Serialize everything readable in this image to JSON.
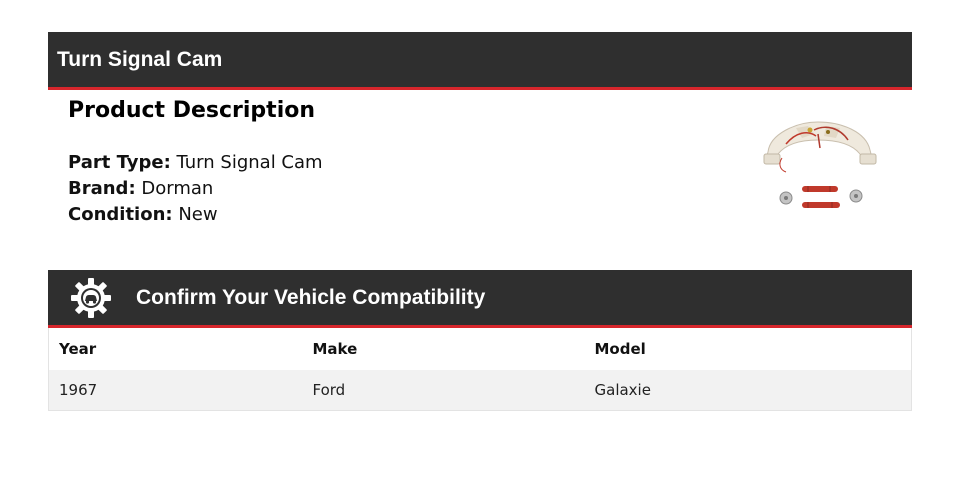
{
  "header": {
    "title": "Turn Signal Cam"
  },
  "description": {
    "heading": "Product Description",
    "specs": [
      {
        "label": "Part Type:",
        "value": "Turn Signal Cam"
      },
      {
        "label": "Brand:",
        "value": "Dorman"
      },
      {
        "label": "Condition:",
        "value": "New"
      }
    ]
  },
  "compatibility": {
    "heading": "Confirm Your Vehicle Compatibility",
    "icon": "gear-car-icon",
    "columns": [
      "Year",
      "Make",
      "Model"
    ],
    "rows": [
      [
        "1967",
        "Ford",
        "Galaxie"
      ]
    ]
  },
  "colors": {
    "bar_bg": "#2f2f2f",
    "accent_red": "#d7262c",
    "row_bg": "#f2f2f2"
  }
}
